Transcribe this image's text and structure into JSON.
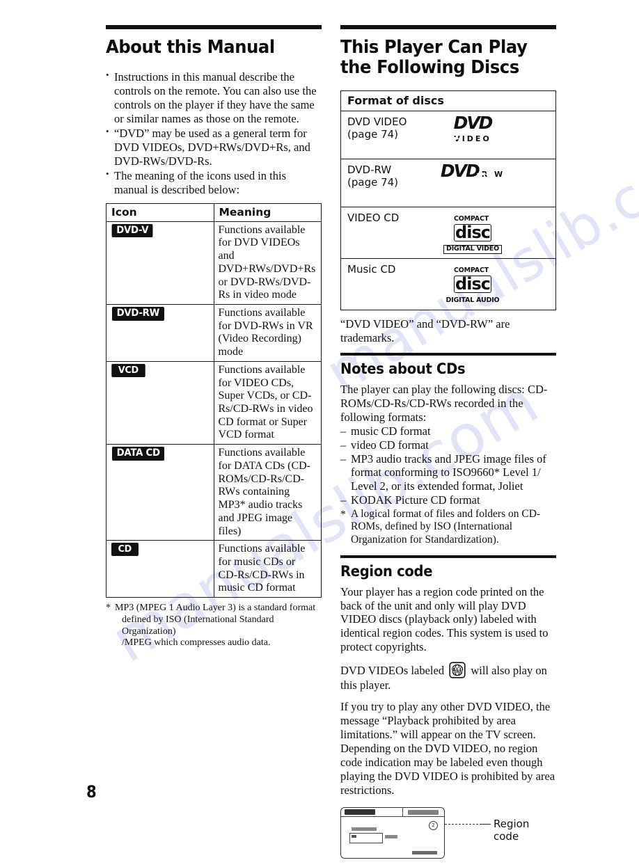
{
  "page": {
    "number": "8",
    "watermark": "manualslib.com"
  },
  "left_column": {
    "heading": "About this Manual",
    "bullets": [
      "Instructions in this manual describe the controls on the remote. You can also use the controls on the player if they have the same or similar names as those on the remote.",
      "“DVD” may be used as a general term for DVD VIDEOs, DVD+RWs/DVD+Rs, and DVD-RWs/DVD-Rs.",
      "The meaning of the icons used in this manual is described below:"
    ],
    "icon_table": {
      "headers": [
        "Icon",
        "Meaning"
      ],
      "rows": [
        {
          "icon": "DVD-V",
          "icon_name": "dvd-v-badge",
          "meaning": "Functions available for DVD VIDEOs and DVD+RWs/DVD+Rs or  DVD-RWs/DVD-Rs in video mode"
        },
        {
          "icon": "DVD-RW",
          "icon_name": "dvd-rw-badge",
          "meaning": "Functions available for DVD-RWs in VR (Video Recording) mode"
        },
        {
          "icon": "VCD",
          "icon_name": "vcd-badge",
          "meaning": "Functions available for VIDEO CDs, Super VCDs, or CD-Rs/CD-RWs in video CD format or Super VCD format"
        },
        {
          "icon": "DATA CD",
          "icon_name": "data-cd-badge",
          "meaning": "Functions available for DATA CDs (CD-ROMs/CD-Rs/CD-RWs containing MP3* audio tracks and JPEG image files)"
        },
        {
          "icon": "CD",
          "icon_name": "cd-badge",
          "meaning": "Functions available for music CDs or CD-Rs/CD-RWs in music CD format"
        }
      ]
    },
    "footnote": {
      "mark": "*",
      "line1": "MP3 (MPEG 1 Audio Layer 3) is a standard format",
      "line2": "defined by ISO (International Standard Organization)",
      "line3": "/MPEG which compresses audio data."
    }
  },
  "right_column": {
    "heading": "This Player Can Play the Following Discs",
    "disc_table": {
      "header": "Format of discs",
      "rows": [
        {
          "name_line1": "DVD VIDEO",
          "name_line2": "(page 74)",
          "logo_type": "dvd",
          "logo_word": "DVD",
          "logo_sub": "VIDEO"
        },
        {
          "name_line1": "DVD-RW",
          "name_line2": "(page 74)",
          "logo_type": "dvd",
          "logo_word": "DVD",
          "logo_sub": "R W"
        },
        {
          "name_line1": "VIDEO CD",
          "name_line2": "",
          "logo_type": "cd",
          "logo_top": "COMPACT",
          "logo_word": "disc",
          "logo_sub": "DIGITAL VIDEO",
          "logo_sub_boxed": true
        },
        {
          "name_line1": "Music CD",
          "name_line2": "",
          "logo_type": "cd",
          "logo_top": "COMPACT",
          "logo_word": "disc",
          "logo_sub": "DIGITAL AUDIO",
          "logo_sub_boxed": false
        }
      ]
    },
    "trademark_note": "“DVD VIDEO” and “DVD-RW” are trademarks.",
    "notes_about_cds": {
      "heading": "Notes about CDs",
      "intro": "The player can play the following discs: CD-ROMs/CD-Rs/CD-RWs recorded in the following formats:",
      "items": [
        "music CD format",
        "video CD format",
        "MP3 audio tracks and JPEG image files of format conforming to ISO9660* Level 1/ Level 2, or its extended format, Joliet",
        "KODAK Picture CD format"
      ],
      "footnote": "A logical format of files and folders on CD-ROMs, defined by ISO (International Organization for Standardization)."
    },
    "region_code": {
      "heading": "Region code",
      "paragraph1": "Your player has a region code printed on the back of the unit and only will play DVD VIDEO discs (playback only) labeled with identical region codes. This system is used to protect copyrights.",
      "paragraph2_before": "DVD VIDEOs labeled",
      "paragraph2_after": "will also play on this player.",
      "all_icon_label": "ALL",
      "paragraph3": "If you try to play any other DVD VIDEO, the message “Playback prohibited by area limitations.” will appear on the TV screen. Depending on the DVD VIDEO, no region code indication may be labeled even though playing the DVD VIDEO is prohibited by area restrictions.",
      "figure": {
        "callout_label": "Region code",
        "region_mark": "2"
      }
    }
  }
}
